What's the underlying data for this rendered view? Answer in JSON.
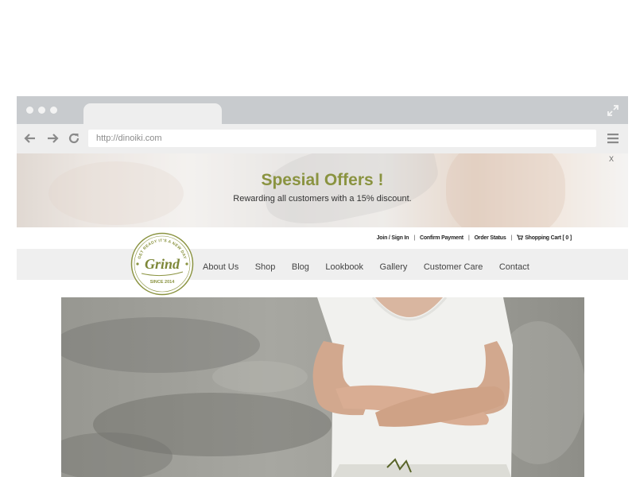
{
  "browser": {
    "url": "http://dinoiki.com"
  },
  "banner": {
    "title": "Spesial Offers !",
    "subtitle": "Rewarding all customers with a 15% discount.",
    "close_label": "X"
  },
  "top_links": {
    "join": "Join / Sign In",
    "confirm": "Confirm Payment",
    "order": "Order Status",
    "cart": "Shopping Cart [ 0 ]"
  },
  "nav": {
    "items": [
      "About Us",
      "Shop",
      "Blog",
      "Lookbook",
      "Gallery",
      "Customer Care",
      "Contact"
    ]
  },
  "logo": {
    "arc_text": "GET READY IT'S A NEW DAY",
    "wordmark": "Grind",
    "since": "SINCE 2014"
  },
  "colors": {
    "brand_olive": "#8a9340",
    "chrome_gray": "#c8cbce",
    "toolbar_gray": "#eeeeee",
    "nav_bg": "#efefef"
  },
  "icons": {
    "back": "back-arrow-icon",
    "forward": "forward-arrow-icon",
    "reload": "reload-icon",
    "menu": "hamburger-menu-icon",
    "expand": "expand-icon",
    "cart": "cart-icon"
  }
}
